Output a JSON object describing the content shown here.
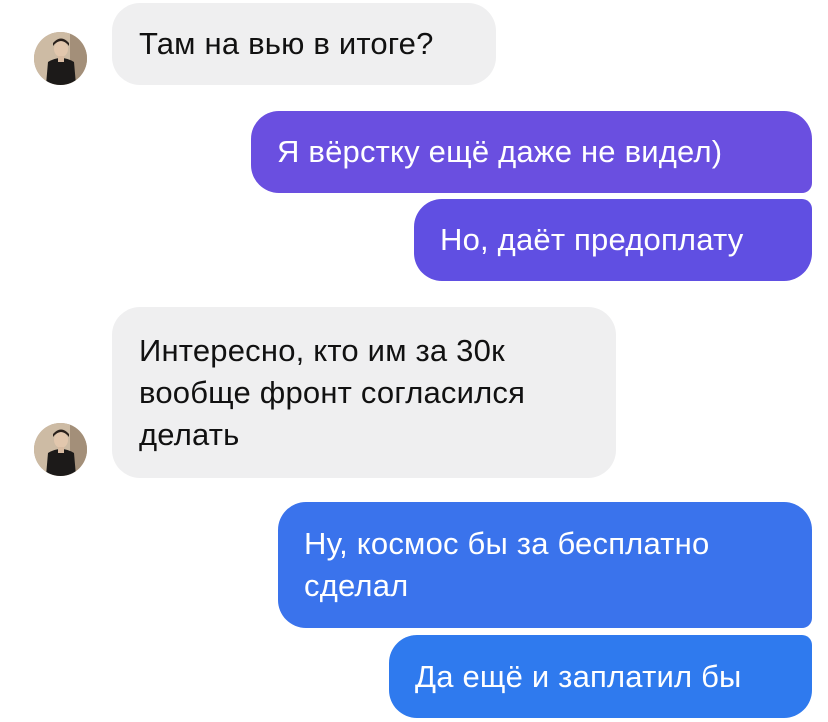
{
  "messages": [
    {
      "text": "Там на вью в итоге?"
    },
    {
      "text": "Я вёрстку ещё даже не видел)"
    },
    {
      "text": "Но, даёт предоплату"
    },
    {
      "text": "Интересно, кто им за 30к\nвообще фронт согласился\nделать"
    },
    {
      "text": "Ну, космос бы за бесплатно\nсделал"
    },
    {
      "text": "Да ещё и заплатил бы"
    }
  ],
  "colors": {
    "incoming_bubble": "#efeff0",
    "outgoing_top": "#6a4fe0",
    "outgoing_bottom": "#2f7aee"
  },
  "icons": {
    "avatar": "contact-avatar-photo"
  }
}
